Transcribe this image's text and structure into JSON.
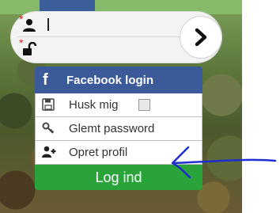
{
  "login": {
    "username_value": "",
    "password_value": "",
    "required_mark": "*"
  },
  "menu": {
    "facebook_icon": "f",
    "facebook_label": "Facebook login",
    "remember_label": "Husk mig",
    "forgot_label": "Glemt password",
    "create_label": "Opret profil",
    "login_label": "Log ind"
  },
  "icons": {
    "user": "user-icon",
    "lock": "unlock-icon",
    "submit": "chevron-right-icon",
    "facebook": "facebook-icon",
    "remember": "floppy-disk-icon",
    "forgot": "key-icon",
    "create": "add-user-icon"
  },
  "colors": {
    "facebook": "#3b5a9a",
    "login_button": "#2aa43a",
    "required": "#e02020",
    "annotation": "#1e2fd0"
  }
}
